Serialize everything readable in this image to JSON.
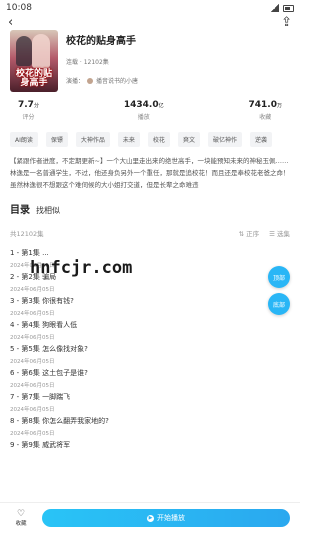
{
  "status": {
    "time": "10:08"
  },
  "topbar": {
    "back_icon": "‹",
    "share_icon": "⇪"
  },
  "book": {
    "cover_text": "校花的贴身高手",
    "title": "校花的贴身高手",
    "meta": "连载 · 12102集",
    "narrator_label": "演播：",
    "narrator": "播音说书的小唐"
  },
  "stats": [
    {
      "num": "7.7",
      "unit": "分",
      "label": "评分"
    },
    {
      "num": "1434.0",
      "unit": "亿",
      "label": "播放"
    },
    {
      "num": "741.0",
      "unit": "万",
      "label": "收藏"
    }
  ],
  "tags": [
    "AI朗读",
    "保镖",
    "大神作品",
    "未来",
    "校花",
    "爽文",
    "破亿神作",
    "逆袭"
  ],
  "description": "【紧跟作者进度，不定期更新~】一个大山里走出来的绝世高手，一块能预知未来的神秘玉佩……林逸是一名普通学生，不过，他还身负另外一个重任，那就是追校花！而且还是奉校花老爸之命！虽然林逸很不想跟这个难伺候的大小姐打交道，但是长辈之命难违",
  "tabs": {
    "active": "目录",
    "other": "找相似"
  },
  "list": {
    "total": "共12102集",
    "sort": "⇅ 正序",
    "select": "☰ 选集"
  },
  "episodes": [
    {
      "title": "1 - 第1集 ...",
      "date": "2024年06月05日"
    },
    {
      "title": "2 - 第2集 骗局",
      "date": "2024年06月05日"
    },
    {
      "title": "3 - 第3集 你很有钱?",
      "date": "2024年06月05日"
    },
    {
      "title": "4 - 第4集 狗眼看人低",
      "date": "2024年06月05日"
    },
    {
      "title": "5 - 第5集 怎么像找对象?",
      "date": "2024年06月05日"
    },
    {
      "title": "6 - 第6集 这土包子是谁?",
      "date": "2024年06月05日"
    },
    {
      "title": "7 - 第7集 一脚踹飞",
      "date": "2024年06月05日"
    },
    {
      "title": "8 - 第8集 你怎么翻弄我家地的?",
      "date": "2024年06月05日"
    },
    {
      "title": "9 - 第9集 威武将军",
      "date": ""
    }
  ],
  "watermark": "hnfcjr.com",
  "float": {
    "top": "顶部",
    "bottom": "底部"
  },
  "bottom": {
    "fav_label": "收藏",
    "fav_icon": "♡",
    "play_label": "开始播放",
    "play_icon": "▶"
  }
}
